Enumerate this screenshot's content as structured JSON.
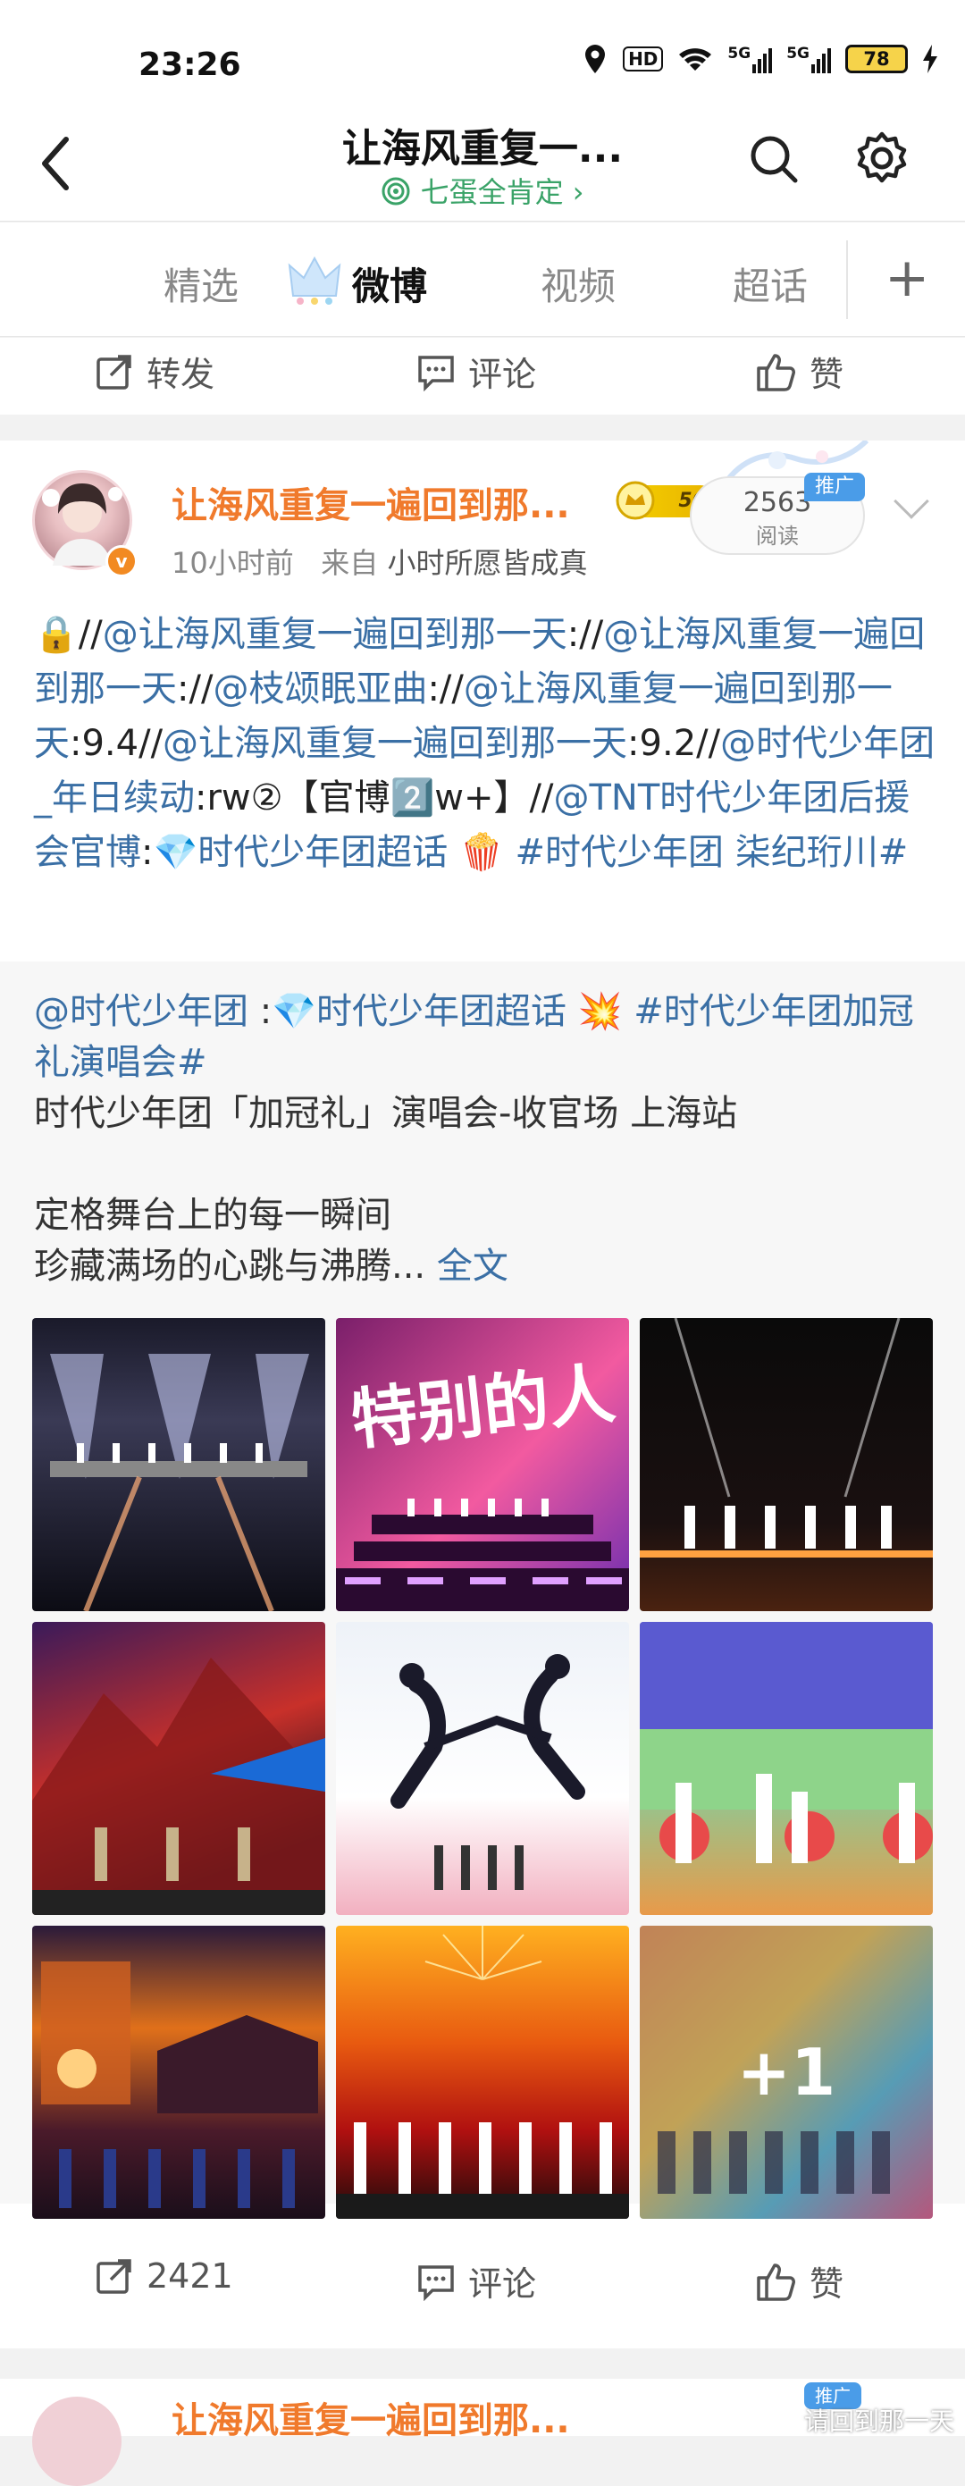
{
  "status_bar": {
    "time": "23:26",
    "hd_label": "HD",
    "net1": "5G",
    "net2": "5G",
    "battery": "78"
  },
  "header": {
    "title": "让海风重复一...",
    "subtitle": "七蛋全肯定 ›"
  },
  "tabs": [
    {
      "label": "精选",
      "active": false
    },
    {
      "label": "微博",
      "active": true
    },
    {
      "label": "视频",
      "active": false
    },
    {
      "label": "超话",
      "active": false
    }
  ],
  "top_actions": {
    "repost": "转发",
    "comment": "评论",
    "like": "赞"
  },
  "post": {
    "username": "让海风重复一遍回到那...",
    "level": "56",
    "time": "10小时前",
    "from_label": "来自",
    "source": "小时所愿皆成真",
    "reads_count": "2563",
    "reads_label": "阅读",
    "ad_tag": "推广",
    "body": [
      {
        "t": "🔒//",
        "c": "normal"
      },
      {
        "t": "@让海风重复一遍回到那一天",
        "c": "link"
      },
      {
        "t": "://",
        "c": "normal"
      },
      {
        "t": "@让海风重复一遍回到那一天",
        "c": "link"
      },
      {
        "t": "://",
        "c": "normal"
      },
      {
        "t": "@枝颂眠亚曲",
        "c": "link"
      },
      {
        "t": "://",
        "c": "normal"
      },
      {
        "t": "@让海风重复一遍回到那一天",
        "c": "link"
      },
      {
        "t": ":9.4//",
        "c": "normal"
      },
      {
        "t": "@让海风重复一遍回到那一天",
        "c": "link"
      },
      {
        "t": ":9.2//",
        "c": "normal"
      },
      {
        "t": "@时代少年团_年日续动",
        "c": "link"
      },
      {
        "t": ":rw②【官博2️⃣w+】//",
        "c": "normal"
      },
      {
        "t": "@TNT时代少年团后援会官博",
        "c": "link"
      },
      {
        "t": ":",
        "c": "normal"
      },
      {
        "t": "💎时代少年团超话",
        "c": "link"
      },
      {
        "t": " 🍿 ",
        "c": "normal"
      },
      {
        "t": "#时代少年团 柒纪珩川#",
        "c": "link"
      }
    ],
    "quoted": {
      "line1": [
        {
          "t": "@时代少年团",
          "c": "link"
        },
        {
          "t": " :",
          "c": "normal"
        },
        {
          "t": "💎时代少年团超话",
          "c": "link"
        },
        {
          "t": " 💥 ",
          "c": "normal"
        },
        {
          "t": "#时代少年团加冠礼演唱会#",
          "c": "link"
        }
      ],
      "line2": "时代少年团「加冠礼」演唱会-收官场 上海站",
      "line3": "定格舞台上的每一瞬间",
      "line4": "珍藏满场的心跳与沸腾...",
      "full_text": "全文",
      "more_images": "+1"
    },
    "actions": {
      "repost_count": "2421",
      "comment": "评论",
      "like": "赞"
    }
  },
  "image_captions": {
    "img2": "特别的人"
  },
  "next_post_preview": {
    "username": "让海风重复一遍回到那...",
    "ad_tag": "推广",
    "overlay_text": "请回到那一天"
  }
}
